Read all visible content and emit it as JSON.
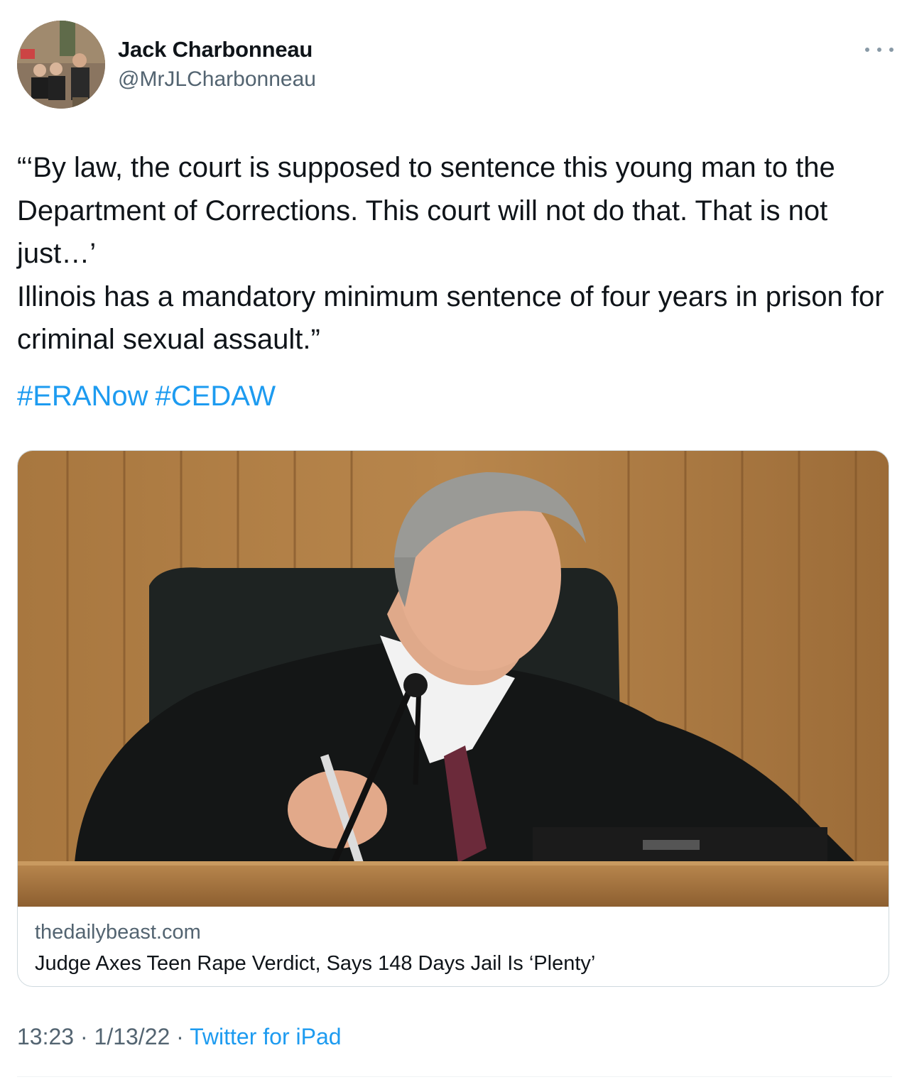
{
  "author": {
    "display_name": "Jack Charbonneau",
    "handle": "@MrJLCharbonneau",
    "avatar_icon": "profile-photo"
  },
  "tweet": {
    "text": "“‘By law, the court is supposed to sentence this young man to the Department of Corrections. This court will not do that. That is not just…’\nIllinois has a mandatory minimum sentence of four years in prison for criminal sexual assault.”",
    "hashtags": [
      "#ERANow",
      "#CEDAW"
    ]
  },
  "link_card": {
    "domain": "thedailybeast.com",
    "title": "Judge Axes Teen Rape Verdict, Says 148 Days Jail Is ‘Plenty’"
  },
  "meta": {
    "time": "13:23",
    "separator": "·",
    "date": "1/13/22",
    "source": "Twitter for iPad"
  },
  "colors": {
    "link": "#1d9bf0",
    "secondary_text": "#536471",
    "primary_text": "#0f1419",
    "border": "#cfd9de"
  }
}
